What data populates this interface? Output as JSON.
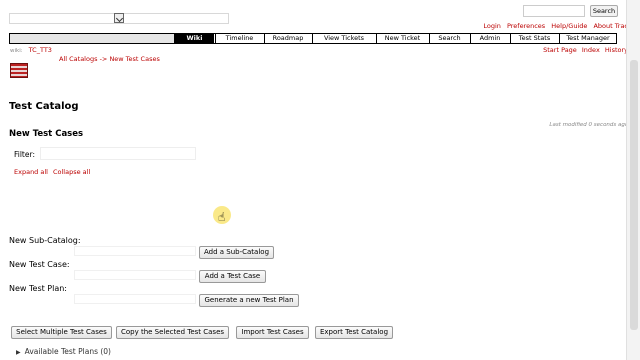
{
  "header": {
    "search_button": "Search",
    "metanav": [
      "Login",
      "Preferences",
      "Help/Guide",
      "About Trac"
    ]
  },
  "mainnav": {
    "tabs": [
      "Wiki",
      "Timeline",
      "Roadmap",
      "View Tickets",
      "New Ticket",
      "Search",
      "Admin",
      "Test Stats",
      "Test Manager"
    ],
    "active": "Wiki"
  },
  "context": {
    "wiki_label": "wiki:",
    "page_name": "TC_TT3",
    "links": [
      "Start Page",
      "Index",
      "History"
    ]
  },
  "breadcrumb": {
    "all_catalogs": "All Catalogs",
    "separator": "->",
    "current": "New Test Cases"
  },
  "page": {
    "title": "Test Catalog",
    "last_modified": "Last modified 0 seconds ago.",
    "section_title": "New Test Cases",
    "filter_label": "Filter:",
    "expand_all": "Expand all",
    "collapse_all": "Collapse all"
  },
  "forms": {
    "sub_catalog_label": "New Sub-Catalog:",
    "sub_catalog_button": "Add a Sub-Catalog",
    "test_case_label": "New Test Case:",
    "test_case_button": "Add a Test Case",
    "test_plan_label": "New Test Plan:",
    "test_plan_button": "Generate a new Test Plan"
  },
  "actions": {
    "select_multiple": "Select Multiple Test Cases",
    "copy_selected": "Copy the Selected Test Cases",
    "import": "Import Test Cases",
    "export": "Export Test Catalog"
  },
  "available_plans": "Available Test Plans (0)",
  "colors": {
    "link": "#bb0000",
    "nav_active_bg": "#000000"
  }
}
